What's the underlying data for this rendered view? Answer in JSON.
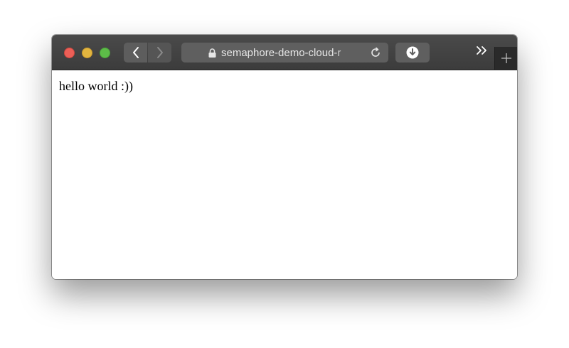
{
  "browser": {
    "address_bar": {
      "url": "semaphore-demo-cloud-r",
      "secure": true
    },
    "icons": {
      "back": "chevron-left-icon",
      "forward": "chevron-right-icon",
      "lock": "lock-icon",
      "reload": "reload-icon",
      "download": "download-icon",
      "overflow": "chevron-double-right-icon",
      "new_tab": "plus-icon"
    },
    "colors": {
      "close": "#ec5f57",
      "minimize": "#e2b53f",
      "zoom": "#5dbc48",
      "toolbar": "#3f3f3f"
    }
  },
  "page": {
    "body_text": "hello world :))"
  }
}
